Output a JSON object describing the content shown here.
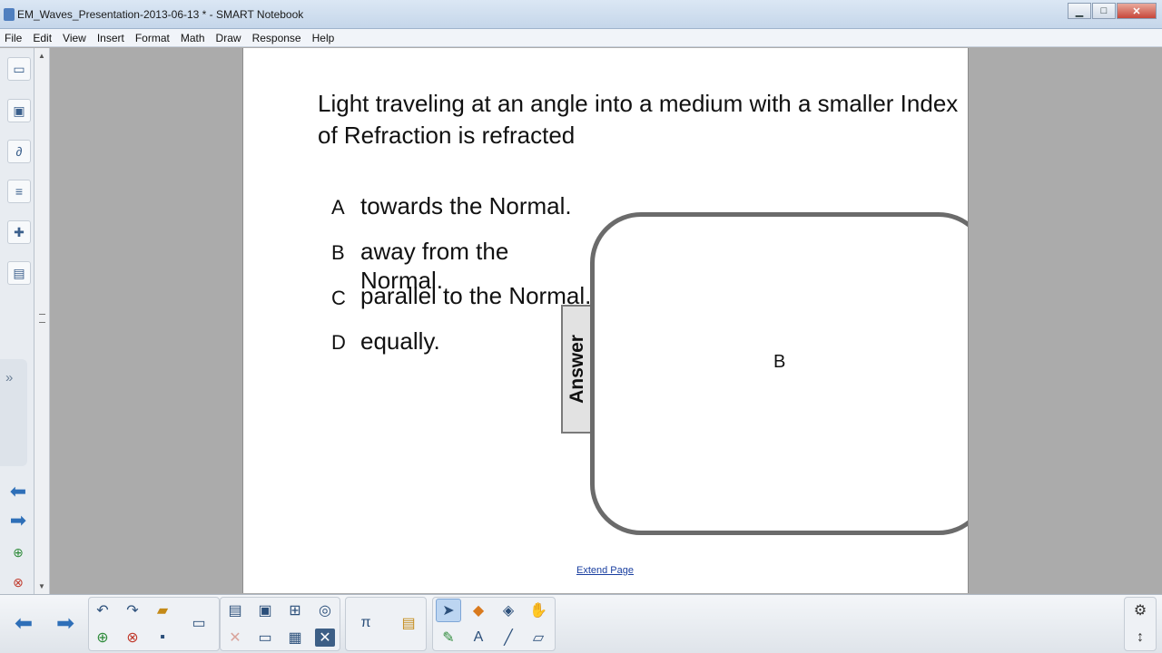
{
  "window": {
    "title": "EM_Waves_Presentation-2013-06-13 * - SMART Notebook",
    "minimize_glyph": "▁",
    "maximize_glyph": "□",
    "close_glyph": "✕"
  },
  "menu": [
    "File",
    "Edit",
    "View",
    "Insert",
    "Format",
    "Math",
    "Draw",
    "Response",
    "Help"
  ],
  "page": {
    "question": "Light traveling at an angle into a medium with a smaller Index of Refraction is refracted",
    "choices": [
      {
        "letter": "A",
        "text": "towards the Normal."
      },
      {
        "letter": "B",
        "text": "away from the"
      },
      {
        "letter": "",
        "text": "Normal."
      },
      {
        "letter": "C",
        "text": "parallel to the Normal."
      },
      {
        "letter": "D",
        "text": "equally."
      }
    ],
    "answer_tab_label": "Answer",
    "answer_value": "B",
    "extend_link": "Extend Page"
  },
  "icons": {
    "sidebar": [
      "page-sorter-icon",
      "gallery-icon",
      "attachments-icon",
      "properties-icon",
      "addons-icon",
      "lesson-activity-icon"
    ],
    "navigation": [
      "previous-page-icon",
      "next-page-icon",
      "add-page-icon",
      "delete-page-icon"
    ],
    "toolbar": [
      "undo-icon",
      "redo-icon",
      "open-file-icon",
      "add-page-icon",
      "delete-page-icon",
      "save-icon",
      "display-icon",
      "paste-icon",
      "screen-shade-icon",
      "full-screen-icon",
      "capture-icon",
      "insert-table-icon",
      "delete-icon",
      "math-tools-icon",
      "lesson-activity-icon",
      "select-icon",
      "shapes-icon",
      "eraser-fill-icon",
      "magic-pen-icon",
      "pen-icon",
      "text-icon",
      "line-icon",
      "eraser-icon",
      "settings-icon",
      "move-toolbar-icon"
    ]
  },
  "colors": {
    "link": "#1a3fa0",
    "nav_arrow": "#2e6fb8",
    "answer_border": "#6b6b6b"
  }
}
